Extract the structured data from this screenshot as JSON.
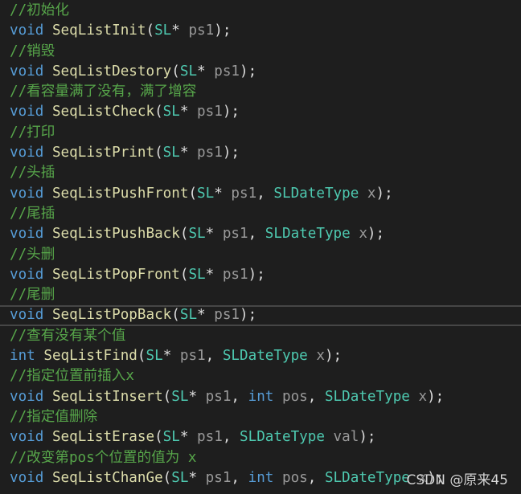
{
  "code_lines": [
    [
      {
        "t": "comment",
        "v": "//初始化"
      }
    ],
    [
      {
        "t": "keyword",
        "v": "void"
      },
      {
        "t": "plain",
        "v": " "
      },
      {
        "t": "func",
        "v": "SeqListInit"
      },
      {
        "t": "punct",
        "v": "("
      },
      {
        "t": "type",
        "v": "SL"
      },
      {
        "t": "punct",
        "v": "* "
      },
      {
        "t": "param",
        "v": "ps1"
      },
      {
        "t": "punct",
        "v": ");"
      }
    ],
    [
      {
        "t": "comment",
        "v": "//销毁"
      }
    ],
    [
      {
        "t": "keyword",
        "v": "void"
      },
      {
        "t": "plain",
        "v": " "
      },
      {
        "t": "func",
        "v": "SeqListDestory"
      },
      {
        "t": "punct",
        "v": "("
      },
      {
        "t": "type",
        "v": "SL"
      },
      {
        "t": "punct",
        "v": "* "
      },
      {
        "t": "param",
        "v": "ps1"
      },
      {
        "t": "punct",
        "v": ");"
      }
    ],
    [
      {
        "t": "comment",
        "v": "//看容量满了没有，满了增容"
      }
    ],
    [
      {
        "t": "keyword",
        "v": "void"
      },
      {
        "t": "plain",
        "v": " "
      },
      {
        "t": "func",
        "v": "SeqListCheck"
      },
      {
        "t": "punct",
        "v": "("
      },
      {
        "t": "type",
        "v": "SL"
      },
      {
        "t": "punct",
        "v": "* "
      },
      {
        "t": "param",
        "v": "ps1"
      },
      {
        "t": "punct",
        "v": ");"
      }
    ],
    [
      {
        "t": "comment",
        "v": "//打印"
      }
    ],
    [
      {
        "t": "keyword",
        "v": "void"
      },
      {
        "t": "plain",
        "v": " "
      },
      {
        "t": "func",
        "v": "SeqListPrint"
      },
      {
        "t": "punct",
        "v": "("
      },
      {
        "t": "type",
        "v": "SL"
      },
      {
        "t": "punct",
        "v": "* "
      },
      {
        "t": "param",
        "v": "ps1"
      },
      {
        "t": "punct",
        "v": ");"
      }
    ],
    [
      {
        "t": "comment",
        "v": "//头插"
      }
    ],
    [
      {
        "t": "keyword",
        "v": "void"
      },
      {
        "t": "plain",
        "v": " "
      },
      {
        "t": "func",
        "v": "SeqListPushFront"
      },
      {
        "t": "punct",
        "v": "("
      },
      {
        "t": "type",
        "v": "SL"
      },
      {
        "t": "punct",
        "v": "* "
      },
      {
        "t": "param",
        "v": "ps1"
      },
      {
        "t": "punct",
        "v": ", "
      },
      {
        "t": "type",
        "v": "SLDateType"
      },
      {
        "t": "plain",
        "v": " "
      },
      {
        "t": "param",
        "v": "x"
      },
      {
        "t": "punct",
        "v": ");"
      }
    ],
    [
      {
        "t": "comment",
        "v": "//尾插"
      }
    ],
    [
      {
        "t": "keyword",
        "v": "void"
      },
      {
        "t": "plain",
        "v": " "
      },
      {
        "t": "func",
        "v": "SeqListPushBack"
      },
      {
        "t": "punct",
        "v": "("
      },
      {
        "t": "type",
        "v": "SL"
      },
      {
        "t": "punct",
        "v": "* "
      },
      {
        "t": "param",
        "v": "ps1"
      },
      {
        "t": "punct",
        "v": ", "
      },
      {
        "t": "type",
        "v": "SLDateType"
      },
      {
        "t": "plain",
        "v": " "
      },
      {
        "t": "param",
        "v": "x"
      },
      {
        "t": "punct",
        "v": ");"
      }
    ],
    [
      {
        "t": "comment",
        "v": "//头删"
      }
    ],
    [
      {
        "t": "keyword",
        "v": "void"
      },
      {
        "t": "plain",
        "v": " "
      },
      {
        "t": "func",
        "v": "SeqListPopFront"
      },
      {
        "t": "punct",
        "v": "("
      },
      {
        "t": "type",
        "v": "SL"
      },
      {
        "t": "punct",
        "v": "* "
      },
      {
        "t": "param",
        "v": "ps1"
      },
      {
        "t": "punct",
        "v": ");"
      }
    ],
    [
      {
        "t": "comment",
        "v": "//尾删"
      }
    ],
    [
      {
        "t": "keyword",
        "v": "void"
      },
      {
        "t": "plain",
        "v": " "
      },
      {
        "t": "func",
        "v": "SeqListPopBack"
      },
      {
        "t": "punct",
        "v": "("
      },
      {
        "t": "type",
        "v": "SL"
      },
      {
        "t": "punct",
        "v": "* "
      },
      {
        "t": "param",
        "v": "ps1"
      },
      {
        "t": "punct",
        "v": ");"
      }
    ],
    [
      {
        "t": "comment",
        "v": "//查有没有某个值"
      }
    ],
    [
      {
        "t": "keyword",
        "v": "int"
      },
      {
        "t": "plain",
        "v": " "
      },
      {
        "t": "func",
        "v": "SeqListFind"
      },
      {
        "t": "punct",
        "v": "("
      },
      {
        "t": "type",
        "v": "SL"
      },
      {
        "t": "punct",
        "v": "* "
      },
      {
        "t": "param",
        "v": "ps1"
      },
      {
        "t": "punct",
        "v": ", "
      },
      {
        "t": "type",
        "v": "SLDateType"
      },
      {
        "t": "plain",
        "v": " "
      },
      {
        "t": "param",
        "v": "x"
      },
      {
        "t": "punct",
        "v": ");"
      }
    ],
    [
      {
        "t": "comment",
        "v": "//指定位置前插入x"
      }
    ],
    [
      {
        "t": "keyword",
        "v": "void"
      },
      {
        "t": "plain",
        "v": " "
      },
      {
        "t": "func",
        "v": "SeqListInsert"
      },
      {
        "t": "punct",
        "v": "("
      },
      {
        "t": "type",
        "v": "SL"
      },
      {
        "t": "punct",
        "v": "* "
      },
      {
        "t": "param",
        "v": "ps1"
      },
      {
        "t": "punct",
        "v": ", "
      },
      {
        "t": "keyword",
        "v": "int"
      },
      {
        "t": "plain",
        "v": " "
      },
      {
        "t": "param",
        "v": "pos"
      },
      {
        "t": "punct",
        "v": ", "
      },
      {
        "t": "type",
        "v": "SLDateType"
      },
      {
        "t": "plain",
        "v": " "
      },
      {
        "t": "param",
        "v": "x"
      },
      {
        "t": "punct",
        "v": ");"
      }
    ],
    [
      {
        "t": "comment",
        "v": "//指定值删除"
      }
    ],
    [
      {
        "t": "keyword",
        "v": "void"
      },
      {
        "t": "plain",
        "v": " "
      },
      {
        "t": "func",
        "v": "SeqListErase"
      },
      {
        "t": "punct",
        "v": "("
      },
      {
        "t": "type",
        "v": "SL"
      },
      {
        "t": "punct",
        "v": "* "
      },
      {
        "t": "param",
        "v": "ps1"
      },
      {
        "t": "punct",
        "v": ", "
      },
      {
        "t": "type",
        "v": "SLDateType"
      },
      {
        "t": "plain",
        "v": " "
      },
      {
        "t": "param",
        "v": "val"
      },
      {
        "t": "punct",
        "v": ");"
      }
    ],
    [
      {
        "t": "comment",
        "v": "//改变第pos个位置的值为 x"
      }
    ],
    [
      {
        "t": "keyword",
        "v": "void"
      },
      {
        "t": "plain",
        "v": " "
      },
      {
        "t": "func",
        "v": "SeqListChanGe"
      },
      {
        "t": "punct",
        "v": "("
      },
      {
        "t": "type",
        "v": "SL"
      },
      {
        "t": "punct",
        "v": "* "
      },
      {
        "t": "param",
        "v": "ps1"
      },
      {
        "t": "punct",
        "v": ", "
      },
      {
        "t": "keyword",
        "v": "int"
      },
      {
        "t": "plain",
        "v": " "
      },
      {
        "t": "param",
        "v": "pos"
      },
      {
        "t": "punct",
        "v": ", "
      },
      {
        "t": "type",
        "v": "SLDateType"
      },
      {
        "t": "plain",
        "v": " "
      },
      {
        "t": "param",
        "v": "x"
      },
      {
        "t": "punct",
        "v": ");"
      }
    ]
  ],
  "current_line_index": 15,
  "watermark": "CSDN @原来45",
  "colors": {
    "background": "#1e1e1e",
    "comment": "#57a64a",
    "keyword": "#569cd6",
    "function": "#dcdcaa",
    "type": "#4ec9b0",
    "parameter": "#9a9a9a",
    "text": "#dcdcdc",
    "current_line_border": "#464646"
  }
}
